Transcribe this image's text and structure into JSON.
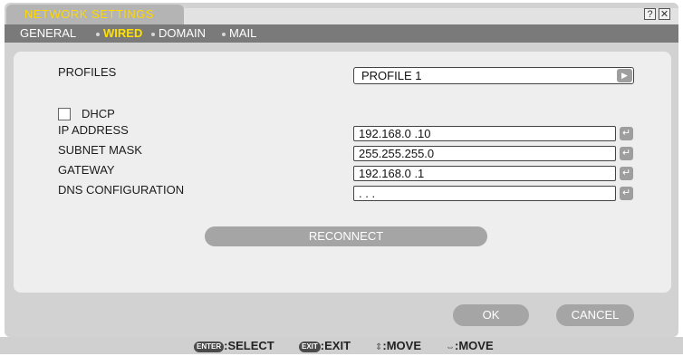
{
  "window": {
    "title": "NETWORK SETTINGS",
    "help_label": "?",
    "close_label": "✕"
  },
  "tabs": [
    {
      "label": "GENERAL"
    },
    {
      "label": "WIRED",
      "active": true
    },
    {
      "label": "DOMAIN"
    },
    {
      "label": "MAIL"
    }
  ],
  "form": {
    "profiles_label": "PROFILES",
    "profile_value": "PROFILE 1",
    "dhcp_label": "DHCP",
    "dhcp_checked": false,
    "ip_label": "IP ADDRESS",
    "ip_value": "192.168.0 .10",
    "subnet_label": "SUBNET MASK",
    "subnet_value": "255.255.255.0",
    "gateway_label": "GATEWAY",
    "gateway_value": "192.168.0 .1",
    "dns_label": "DNS CONFIGURATION",
    "dns_value": " .  .  .",
    "enter_glyph": "↵",
    "arrow_glyph": "▶"
  },
  "buttons": {
    "reconnect": "RECONNECT",
    "ok": "OK",
    "cancel": "CANCEL"
  },
  "footer": {
    "select_key": "ENTER",
    "select_text": ":SELECT",
    "exit_key": "EXIT",
    "exit_text": ":EXIT",
    "move_v_glyph": "⇕",
    "move_v_text": ":MOVE",
    "move_h_glyph": "⇔",
    "move_h_text": ":MOVE"
  },
  "colors": {
    "title_text": "#ffd800",
    "active_tab": "#ffe000",
    "menubar_bg": "#7a7a7a",
    "button_bg": "#a5a5a5"
  }
}
